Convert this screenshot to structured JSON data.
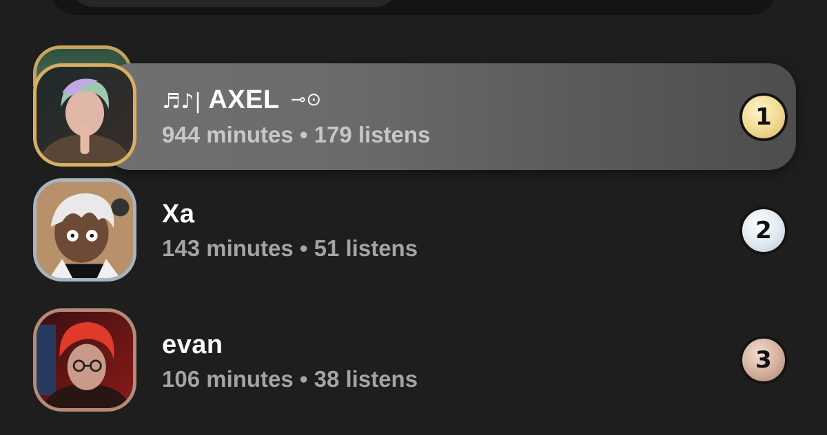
{
  "leaderboard": [
    {
      "rank": "1",
      "name_prefix": "♬♪|",
      "name": "AXEL",
      "name_suffix": "⊸⊙",
      "stats": "944 minutes • 179 listens",
      "medal": "gold"
    },
    {
      "rank": "2",
      "name_prefix": "",
      "name": "Xa",
      "name_suffix": "",
      "stats": "143 minutes • 51 listens",
      "medal": "silver"
    },
    {
      "rank": "3",
      "name_prefix": "",
      "name": "evan",
      "name_suffix": "",
      "stats": "106 minutes • 38 listens",
      "medal": "bronze"
    }
  ],
  "colors": {
    "background": "#1e1e1e",
    "gold": "#d9b062",
    "silver": "#a9b4bf",
    "bronze": "#b58b76",
    "stats_text": "#a4a4a4"
  },
  "icons": {
    "avatar_1": "avatar-photo-green-hair",
    "avatar_2": "avatar-illustration-character",
    "avatar_3": "avatar-photo-red-hair"
  }
}
